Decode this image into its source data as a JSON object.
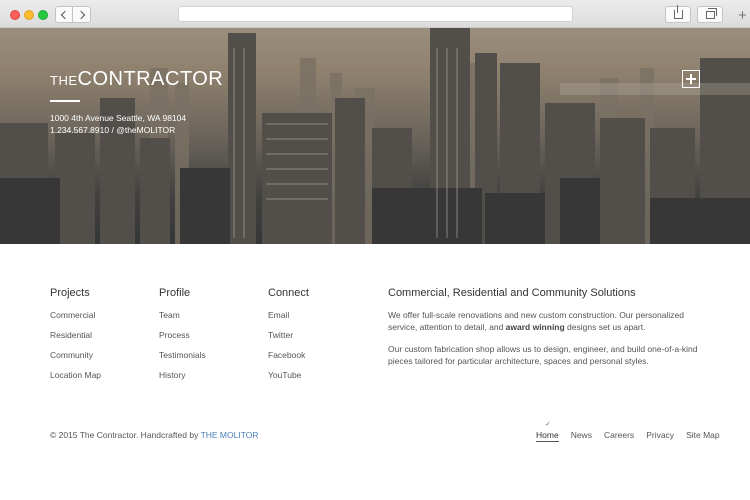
{
  "browser": {
    "back_icon": "chevron-left-icon",
    "forward_icon": "chevron-right-icon",
    "share_icon": "share-icon",
    "tabs_icon": "tabs-icon",
    "new_tab_label": "+"
  },
  "hero": {
    "logo_small": "THE",
    "logo_big": "CONTRACTOR",
    "address_line": "1000 4th Avenue Seattle, WA 98104",
    "phone": "1.234.567.8910",
    "separator": "/",
    "handle": "@theMOLITOR",
    "menu_button_icon": "plus-icon"
  },
  "columns": {
    "projects": {
      "title": "Projects",
      "items": [
        "Commercial",
        "Residential",
        "Community",
        "Location Map"
      ]
    },
    "profile": {
      "title": "Profile",
      "items": [
        "Team",
        "Process",
        "Testimonials",
        "History"
      ]
    },
    "connect": {
      "title": "Connect",
      "items": [
        "Email",
        "Twitter",
        "Facebook",
        "YouTube"
      ]
    }
  },
  "about": {
    "title": "Commercial, Residential and Community Solutions",
    "p1_before": "We offer full-scale renovations and new custom construction. Our personalized service, attention to detail, and ",
    "p1_bold": "award winning",
    "p1_after": " designs set us apart.",
    "p2": "Our custom fabrication shop allows us to design, engineer, and build one-of-a-kind pieces tailored for particular architecture, spaces and personal styles."
  },
  "footer": {
    "copyright_prefix": "© 2015 The Contractor. Handcrafted by",
    "brand": "THE MOLITOR",
    "nav": [
      "Home",
      "News",
      "Careers",
      "Privacy",
      "Site Map"
    ],
    "active_indicator": "✓"
  },
  "colors": {
    "link_accent": "#4a7fb5",
    "text": "#555555",
    "heading": "#333333"
  }
}
